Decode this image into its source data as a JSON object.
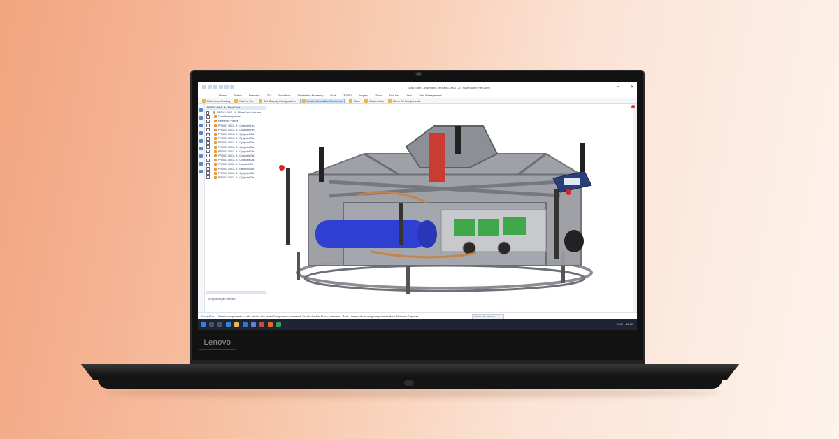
{
  "device": {
    "brand": "Lenovo"
  },
  "app": {
    "title": "Solid Edge - Assembly - [PR0001 0001 - A - PlaceCircle_Hex.asm]",
    "ribbon_tabs": [
      "Home",
      "Sketch",
      "Features",
      "3D",
      "Simulation",
      "Simulation Assembly",
      "Draft",
      "3D PDI",
      "Inspect",
      "Tools",
      "Add-Ins",
      "View",
      "Data Management"
    ],
    "ribbon_buttons": [
      {
        "label": "Reference Routing",
        "active": false
      },
      {
        "label": "Pattern Part",
        "active": false
      },
      {
        "label": "Bolt Display Configuration",
        "active": false
      },
      {
        "label": "Create Selectable Reference",
        "active": true
      },
      {
        "label": "Save",
        "active": false
      },
      {
        "label": "Assemblies",
        "active": false
      },
      {
        "label": "Mirror All Components",
        "active": false
      }
    ],
    "tree": {
      "header": "PR0001 0001 - A - PlaceCircle",
      "items": [
        {
          "label": "PR0001 0001 - A - PlaceCircle Hex.asm",
          "selected": false
        },
        {
          "label": "Coordinate systems",
          "selected": false
        },
        {
          "label": "Reference Planes",
          "selected": false
        },
        {
          "label": "PR0001 0001 - A - Cyclpoint Hex",
          "selected": false
        },
        {
          "label": "PR0001 0001 - A - Cyclpoint Hex",
          "selected": false
        },
        {
          "label": "PR0001 0001 - A - Cyclpoint Dist",
          "selected": false
        },
        {
          "label": "PR0001 0001 - A - Cyclpoint Dist",
          "selected": false
        },
        {
          "label": "PR0001 0001 - A - Cyclpoint Dist",
          "selected": false
        },
        {
          "label": "PR0001 0001 - A - Cyclpoint Dist",
          "selected": false
        },
        {
          "label": "PR0001 0001 - A - Cyclpoint Dist",
          "selected": false
        },
        {
          "label": "PR0001 0001 - A - Cyclpoint Dist",
          "selected": false
        },
        {
          "label": "PR0001 0001 - A - Cyclpoint Dist",
          "selected": false
        },
        {
          "label": "PR0001 0001 - A - Logostrik 20",
          "selected": false
        },
        {
          "label": "PR0001 0001 - A - Electric Motor",
          "selected": false
        },
        {
          "label": "PR0001 0001 - A - Cyclpoint Dist",
          "selected": false
        },
        {
          "label": "PR0001 0001 - A - Cyclpoint Dist",
          "selected": false
        }
      ],
      "footer": "No top level part selected"
    },
    "status": {
      "tag": "PromptBar",
      "message": "Select components to add or click the Insert Component command. Create Part In-Place command. Parts Library tab or drag components from Windows Explorer.",
      "search_placeholder": "Search new selection"
    },
    "tray": {
      "time": "16:40",
      "lang": "ENG"
    }
  },
  "colors": {
    "background_start": "#f2a47f",
    "background_end": "#fdf3ec",
    "taskbar": "#1e2433",
    "accent": "#2a5ea6"
  }
}
